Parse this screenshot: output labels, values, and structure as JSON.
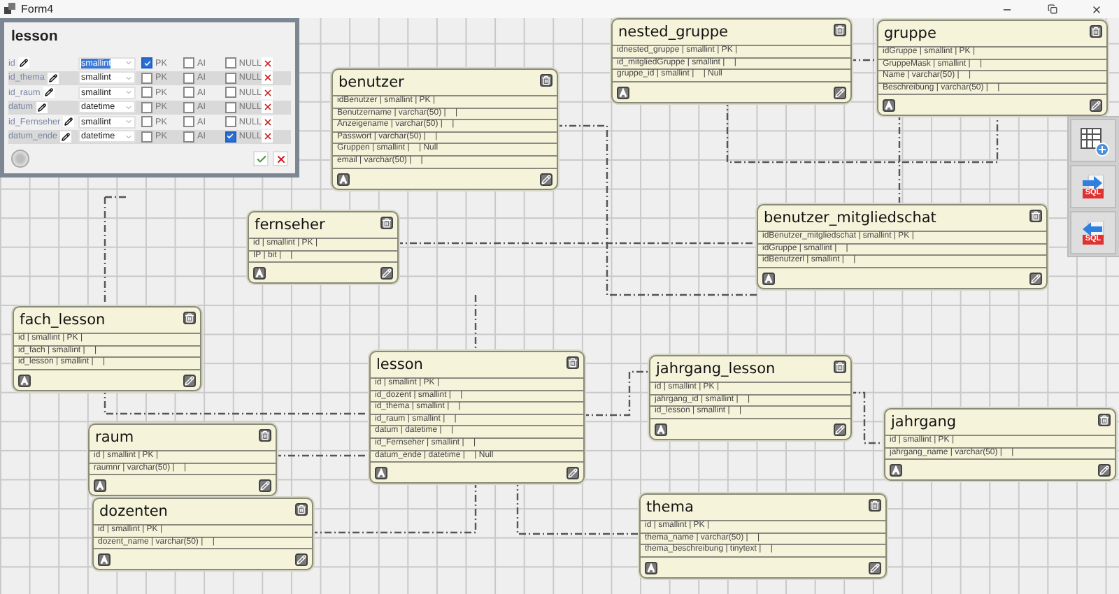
{
  "window": {
    "title": "Form4"
  },
  "editor": {
    "title": "lesson",
    "columns": [
      {
        "name": "id",
        "type": "smallint",
        "type_selected": true,
        "flags": [
          {
            "label": "PK",
            "checked": true
          },
          {
            "label": "AI",
            "checked": false
          },
          {
            "label": "NULL",
            "checked": false
          }
        ]
      },
      {
        "name": "id_thema",
        "type": "smallint",
        "type_selected": false,
        "flags": [
          {
            "label": "PK",
            "checked": false
          },
          {
            "label": "AI",
            "checked": false
          },
          {
            "label": "NULL",
            "checked": false
          }
        ]
      },
      {
        "name": "id_raum",
        "type": "smallint",
        "type_selected": false,
        "flags": [
          {
            "label": "PK",
            "checked": false
          },
          {
            "label": "AI",
            "checked": false
          },
          {
            "label": "NULL",
            "checked": false
          }
        ]
      },
      {
        "name": "datum",
        "type": "datetime",
        "type_selected": false,
        "flags": [
          {
            "label": "PK",
            "checked": false
          },
          {
            "label": "AI",
            "checked": false
          },
          {
            "label": "NULL",
            "checked": false
          }
        ]
      },
      {
        "name": "id_Fernseher",
        "type": "smallint",
        "type_selected": false,
        "flags": [
          {
            "label": "PK",
            "checked": false
          },
          {
            "label": "AI",
            "checked": false
          },
          {
            "label": "NULL",
            "checked": false
          }
        ]
      },
      {
        "name": "datum_ende",
        "type": "datetime",
        "type_selected": false,
        "flags": [
          {
            "label": "PK",
            "checked": false
          },
          {
            "label": "AI",
            "checked": false
          },
          {
            "label": "NULL",
            "checked": true
          }
        ]
      }
    ]
  },
  "toolbar": [
    {
      "kind": "add-table"
    },
    {
      "kind": "export-sql",
      "label": "SQL"
    },
    {
      "kind": "import-sql",
      "label": "SQL"
    }
  ],
  "tables": [
    {
      "name": "benutzer",
      "fields": [
        "idBenutzer | smallint | PK |",
        "Benutzername | varchar(50) |    |",
        "Anzeigename | varchar(50) |    |",
        "Passwort | varchar(50) |    |",
        "Gruppen | smallint |    | Null",
        "email | varchar(50) |    |"
      ]
    },
    {
      "name": "nested_gruppe",
      "fields": [
        "idnested_gruppe | smallint | PK |",
        "id_mitgliedGruppe | smallint |    |",
        "gruppe_id | smallint |    | Null"
      ]
    },
    {
      "name": "gruppe",
      "fields": [
        "idGruppe | smallint | PK |",
        "GruppeMask | smallint |    |",
        "Name | varchar(50) |    |",
        "Beschreibung | varchar(50) |    |"
      ]
    },
    {
      "name": "fernseher",
      "fields": [
        "id | smallint | PK |",
        "IP | bit |    |"
      ]
    },
    {
      "name": "benutzer_mitgliedschat",
      "fields": [
        "idBenutzer_mitgliedschat | smallint | PK |",
        "idGruppe | smallint |    |",
        "idBenutzerl | smallint |    |"
      ]
    },
    {
      "name": "fach_lesson",
      "fields": [
        "id | smallint | PK |",
        "id_fach | smallint |    |",
        "id_lesson | smallint |    |"
      ]
    },
    {
      "name": "lesson",
      "fields": [
        "id | smallint | PK |",
        "id_dozent | smallint |    |",
        "id_thema | smallint |    |",
        "id_raum | smallint |    |",
        "datum | datetime |    |",
        "id_Fernseher | smallint |    |",
        "datum_ende | datetime |    | Null"
      ]
    },
    {
      "name": "jahrgang_lesson",
      "fields": [
        "id | smallint | PK |",
        "jahrgang_id | smallint |    |",
        "id_lesson | smallint |    |"
      ]
    },
    {
      "name": "jahrgang",
      "fields": [
        "id | smallint | PK |",
        "jahrgang_name | varchar(50) |    |"
      ]
    },
    {
      "name": "raum",
      "fields": [
        "id | smallint | PK |",
        "raumnr | varchar(50) |    |"
      ]
    },
    {
      "name": "dozenten",
      "fields": [
        "id | smallint | PK |",
        "dozent_name | varchar(50) |    |"
      ]
    },
    {
      "name": "thema",
      "fields": [
        "id | smallint | PK |",
        "thema_name | varchar(50) |    |",
        "thema_beschreibung | tinytext |    |"
      ]
    }
  ]
}
